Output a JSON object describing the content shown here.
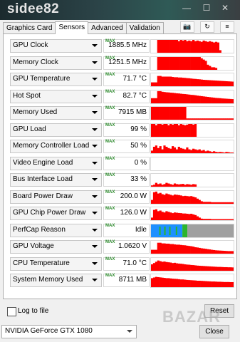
{
  "app": {
    "title_fragment": "sidee82",
    "toolbar_icons": [
      "camera-icon",
      "refresh-icon",
      "menu-icon"
    ]
  },
  "tabs": [
    {
      "label": "Graphics Card",
      "active": false
    },
    {
      "label": "Sensors",
      "active": true
    },
    {
      "label": "Advanced",
      "active": false
    },
    {
      "label": "Validation",
      "active": false
    }
  ],
  "sensors": [
    {
      "name": "GPU Clock",
      "badge": "MAX",
      "value": "1885.5 MHz",
      "graph": [
        0,
        0,
        0,
        1,
        1,
        1,
        1,
        1,
        1,
        1,
        1,
        1,
        1,
        0.9,
        1,
        0.95,
        1,
        0.9,
        0.95,
        0.9,
        1,
        0.9,
        0.95,
        0.9,
        0.85,
        0.95,
        0.9,
        0.85,
        0.9,
        0.85,
        0.8,
        0.85,
        0.8,
        0.2,
        0,
        0,
        0,
        0,
        0,
        0
      ]
    },
    {
      "name": "Memory Clock",
      "badge": "MAX",
      "value": "1251.5 MHz",
      "graph": [
        0,
        0,
        0,
        1,
        1,
        1,
        1,
        1,
        1,
        1,
        1,
        1,
        1,
        1,
        1,
        1,
        1,
        1,
        1,
        1,
        1,
        1,
        1,
        1,
        0.9,
        0.8,
        0.7,
        0.4,
        0.3,
        0.2,
        0.2,
        0.15,
        0,
        0,
        0,
        0,
        0,
        0,
        0,
        0
      ]
    },
    {
      "name": "GPU Temperature",
      "badge": "MAX",
      "value": "71.7 °C",
      "graph": [
        0.3,
        0.3,
        0.3,
        0.8,
        0.8,
        0.75,
        0.75,
        0.75,
        0.75,
        0.75,
        0.72,
        0.7,
        0.7,
        0.68,
        0.68,
        0.66,
        0.65,
        0.63,
        0.62,
        0.6,
        0.58,
        0.57,
        0.55,
        0.54,
        0.52,
        0.5,
        0.49,
        0.48,
        0.47,
        0.46,
        0.45,
        0.44,
        0.43,
        0.42,
        0.41,
        0.4,
        0.39,
        0.38,
        0.37,
        0.36
      ]
    },
    {
      "name": "Hot Spot",
      "badge": "MAX",
      "value": "82.7 °C",
      "graph": [
        0.4,
        0.4,
        0.4,
        0.95,
        0.95,
        0.9,
        0.88,
        0.86,
        0.85,
        0.83,
        0.82,
        0.8,
        0.78,
        0.77,
        0.75,
        0.73,
        0.72,
        0.7,
        0.68,
        0.66,
        0.65,
        0.63,
        0.6,
        0.58,
        0.56,
        0.54,
        0.52,
        0.5,
        0.48,
        0.46,
        0.44,
        0.42,
        0.41,
        0.4,
        0.38,
        0.37,
        0.36,
        0.35,
        0.34,
        0.33
      ]
    },
    {
      "name": "Memory Used",
      "badge": "MAX",
      "value": "7915 MB",
      "graph": [
        1,
        1,
        1,
        1,
        1,
        1,
        1,
        1,
        1,
        1,
        1,
        1,
        1,
        1,
        1,
        1,
        1,
        0.1,
        0.1,
        0.1,
        0.1,
        0.1,
        0.1,
        0.1,
        0.1,
        0.1,
        0.1,
        0.1,
        0.1,
        0.1,
        0.1,
        0.1,
        0.1,
        0.1,
        0.1,
        0.1,
        0.1,
        0.1,
        0.1,
        0.1
      ]
    },
    {
      "name": "GPU Load",
      "badge": "MAX",
      "value": "99 %",
      "graph": [
        1,
        1,
        0.9,
        1,
        1,
        0.95,
        1,
        1,
        0.9,
        1,
        0.95,
        1,
        1,
        0.9,
        1,
        0.95,
        0.9,
        0.95,
        1,
        1,
        0.95,
        1,
        0,
        0,
        0,
        0,
        0,
        0,
        0,
        0,
        0,
        0,
        0,
        0,
        0,
        0,
        0,
        0,
        0,
        0
      ]
    },
    {
      "name": "Memory Controller Load",
      "badge": "MAX",
      "value": "50 %",
      "graph": [
        0.2,
        0.5,
        0.6,
        0.4,
        0.55,
        0.3,
        0.6,
        0.5,
        0.4,
        0.35,
        0.55,
        0.45,
        0.3,
        0.5,
        0.4,
        0.35,
        0.3,
        0.45,
        0.3,
        0.25,
        0.35,
        0.3,
        0.25,
        0.3,
        0.2,
        0.25,
        0.15,
        0.2,
        0.15,
        0.1,
        0.15,
        0.1,
        0.08,
        0.1,
        0.08,
        0.05,
        0.1,
        0.08,
        0.05,
        0.05
      ]
    },
    {
      "name": "Video Engine Load",
      "badge": "MAX",
      "value": "0 %",
      "graph": [
        0,
        0,
        0,
        0,
        0,
        0,
        0,
        0,
        0,
        0,
        0,
        0,
        0,
        0,
        0,
        0,
        0,
        0,
        0,
        0,
        0,
        0,
        0,
        0,
        0,
        0,
        0,
        0,
        0,
        0,
        0,
        0,
        0,
        0,
        0,
        0,
        0,
        0,
        0,
        0
      ]
    },
    {
      "name": "Bus Interface Load",
      "badge": "MAX",
      "value": "33 %",
      "graph": [
        0.1,
        0.15,
        0.3,
        0.2,
        0.25,
        0.15,
        0.2,
        0.3,
        0.25,
        0.2,
        0.15,
        0.25,
        0.2,
        0.18,
        0.2,
        0.22,
        0.15,
        0.2,
        0.18,
        0.15,
        0.2,
        0.18,
        0,
        0,
        0,
        0,
        0,
        0,
        0,
        0,
        0,
        0,
        0,
        0,
        0,
        0,
        0,
        0,
        0,
        0
      ]
    },
    {
      "name": "Board Power Draw",
      "badge": "MAX",
      "value": "200.0 W",
      "graph": [
        0.3,
        0.9,
        0.95,
        0.8,
        0.85,
        0.75,
        0.7,
        0.8,
        0.75,
        0.7,
        0.65,
        0.72,
        0.7,
        0.68,
        0.65,
        0.6,
        0.62,
        0.6,
        0.58,
        0.6,
        0.55,
        0.5,
        0.4,
        0.3,
        0.2,
        0.15,
        0.15,
        0.15,
        0.15,
        0.12,
        0.12,
        0.12,
        0.12,
        0.12,
        0.12,
        0.12,
        0.12,
        0.12,
        0.12,
        0.12
      ]
    },
    {
      "name": "GPU Chip Power Draw",
      "badge": "MAX",
      "value": "126.0 W",
      "graph": [
        0.2,
        0.8,
        0.85,
        0.7,
        0.75,
        0.65,
        0.6,
        0.7,
        0.65,
        0.6,
        0.55,
        0.6,
        0.58,
        0.56,
        0.55,
        0.52,
        0.52,
        0.5,
        0.48,
        0.5,
        0.45,
        0.4,
        0.3,
        0.2,
        0.12,
        0.1,
        0.1,
        0.1,
        0.1,
        0.08,
        0.08,
        0.08,
        0.08,
        0.08,
        0.08,
        0.08,
        0.08,
        0.08,
        0.08,
        0.08
      ]
    },
    {
      "name": "PerfCap Reason",
      "badge": "MAX",
      "value": "Idle",
      "graph_type": "perfcap"
    },
    {
      "name": "GPU Voltage",
      "badge": "MAX",
      "value": "1.0620 V",
      "graph": [
        0.3,
        0.3,
        0.3,
        0.85,
        0.85,
        0.8,
        0.8,
        0.78,
        0.78,
        0.75,
        0.75,
        0.72,
        0.7,
        0.7,
        0.68,
        0.66,
        0.65,
        0.62,
        0.6,
        0.58,
        0.55,
        0.5,
        0.48,
        0.45,
        0.42,
        0.4,
        0.38,
        0.35,
        0.33,
        0.3,
        0.28,
        0.26,
        0.25,
        0.24,
        0.23,
        0.22,
        0.21,
        0.2,
        0.2,
        0.2
      ]
    },
    {
      "name": "CPU Temperature",
      "badge": "MAX",
      "value": "71.0 °C",
      "graph": [
        0.5,
        0.6,
        0.7,
        0.8,
        0.75,
        0.7,
        0.72,
        0.68,
        0.66,
        0.64,
        0.6,
        0.62,
        0.58,
        0.56,
        0.55,
        0.53,
        0.5,
        0.48,
        0.47,
        0.45,
        0.44,
        0.42,
        0.4,
        0.39,
        0.38,
        0.37,
        0.36,
        0.35,
        0.34,
        0.33,
        0.32,
        0.31,
        0.3,
        0.3,
        0.29,
        0.28,
        0.28,
        0.27,
        0.27,
        0.26
      ]
    },
    {
      "name": "System Memory Used",
      "badge": "MAX",
      "value": "8711 MB",
      "graph": [
        0.7,
        0.75,
        0.8,
        0.78,
        0.76,
        0.74,
        0.72,
        0.7,
        0.7,
        0.68,
        0.66,
        0.65,
        0.64,
        0.62,
        0.6,
        0.6,
        0.58,
        0.56,
        0.55,
        0.54,
        0.53,
        0.52,
        0.5,
        0.5,
        0.49,
        0.48,
        0.47,
        0.46,
        0.45,
        0.44,
        0.44,
        0.43,
        0.42,
        0.42,
        0.41,
        0.4,
        0.4,
        0.4,
        0.39,
        0.39
      ]
    }
  ],
  "footer": {
    "log_label": "Log to file",
    "log_checked": false,
    "reset_label": "Reset",
    "close_label": "Close",
    "gpu_selected": "NVIDIA GeForce GTX 1080",
    "watermark": "BAZAR"
  },
  "colors": {
    "graph": "#ff0000",
    "perfcap_blue": "#1e90ff",
    "perfcap_green": "#2db52d",
    "perfcap_gray": "#a0a0a0"
  }
}
